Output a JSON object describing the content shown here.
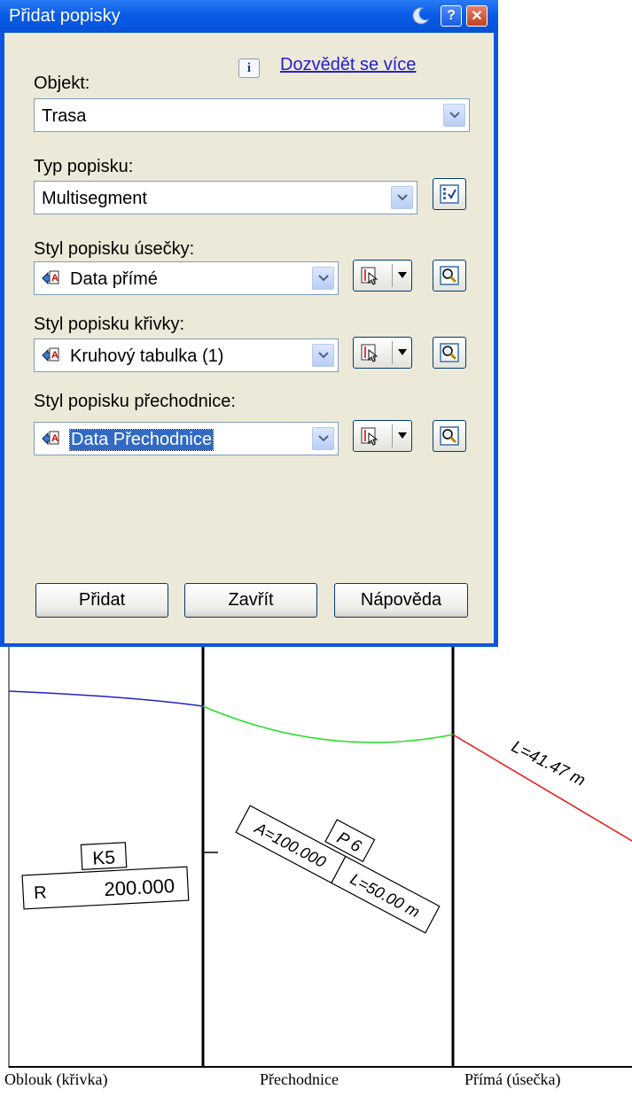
{
  "dialog": {
    "title": "Přidat popisky",
    "help_button": "?",
    "close_button": "✕",
    "info_glyph": "i",
    "learn_more_link": "Dozvědět se více",
    "object_label": "Objekt:",
    "object_value": "Trasa",
    "label_type_label": "Typ popisku:",
    "label_type_value": "Multisegment",
    "line_style_label": "Styl popisku úsečky:",
    "line_style_value": "Data přímé",
    "curve_style_label": "Styl popisku křivky:",
    "curve_style_value": "Kruhový tabulka (1)",
    "spiral_style_label": "Styl popisku přechodnice:",
    "spiral_style_value": "Data Přechodnice",
    "add_button": "Přidat",
    "close_label": "Zavřít",
    "help_label": "Nápověda"
  },
  "drawing": {
    "curve_tag": "K5",
    "curve_radius_letter": "R",
    "curve_radius_value": "200.000",
    "spiral_tag": "P 6",
    "spiral_a": "A=100.000",
    "spiral_l": "L=50.00 m",
    "tangent_length": "L=41.47 m",
    "colors": {
      "curve": "#2020c8",
      "spiral": "#22dd22",
      "tangent": "#ee1111"
    }
  },
  "captions": {
    "curve": "Oblouk (křivka)",
    "spiral": "Přechodnice",
    "tangent": "Přímá (úsečka)"
  }
}
